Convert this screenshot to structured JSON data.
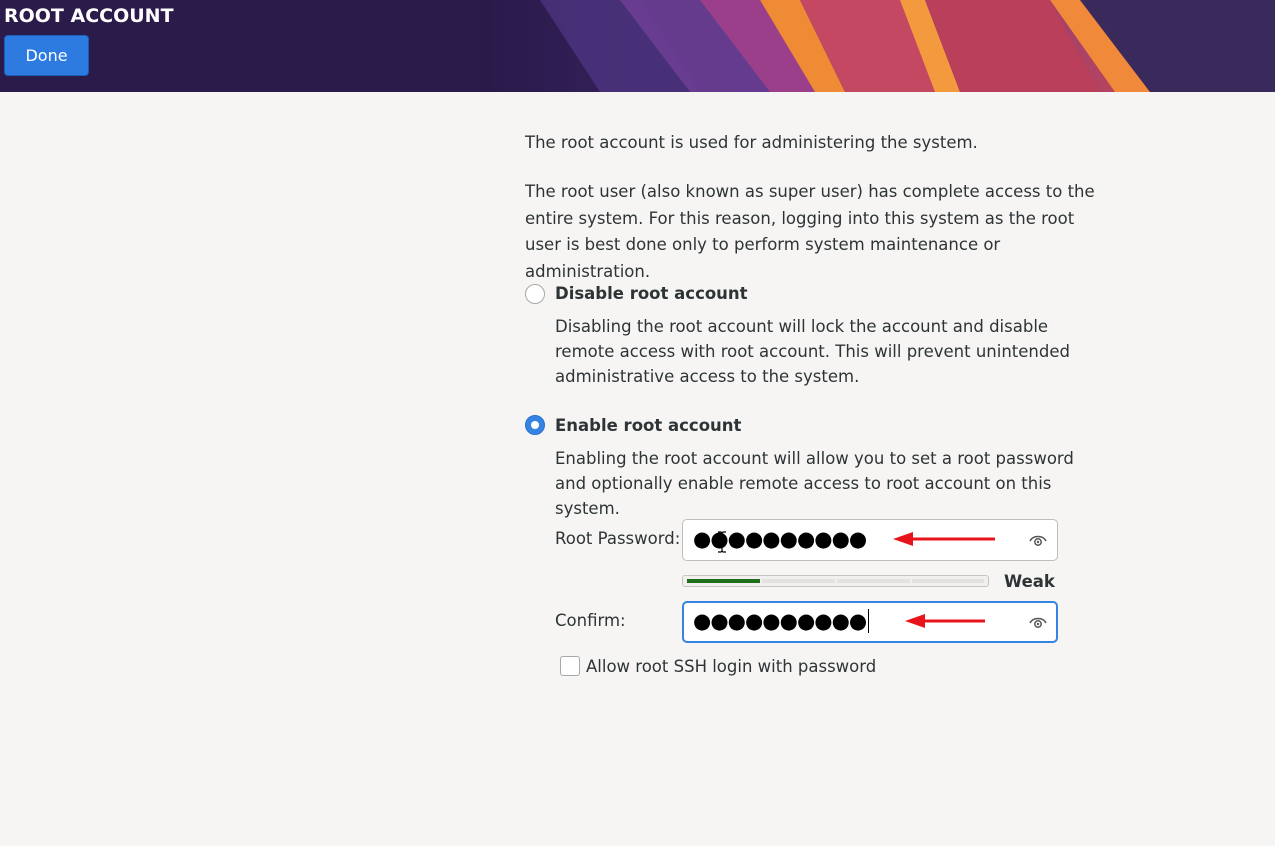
{
  "header": {
    "title": "ROOT ACCOUNT",
    "done_label": "Done"
  },
  "intro": {
    "line1": "The root account is used for administering the system.",
    "line2": "The root user (also known as super user) has complete access to the entire system. For this reason, logging into this system as the root user is best done only to perform system maintenance or administration."
  },
  "options": {
    "disable": {
      "label": "Disable root account",
      "description": "Disabling the root account will lock the account and disable remote access with root account. This will prevent unintended administrative access to the system.",
      "selected": false
    },
    "enable": {
      "label": "Enable root account",
      "description": "Enabling the root account will allow you to set a root password and optionally enable remote access to root account on this system.",
      "selected": true
    }
  },
  "password": {
    "label": "Root Password:",
    "value": "●●●●●●●●●●",
    "strength_label": "Weak",
    "strength_fraction": 0.25
  },
  "confirm": {
    "label": "Confirm:",
    "value": "●●●●●●●●●●"
  },
  "ssh": {
    "label": "Allow root SSH login with password",
    "checked": false
  },
  "colors": {
    "accent": "#3584e4",
    "done_button": "#2d7be0",
    "strength_weak": "#1d6f1a",
    "annotation_arrow": "#e8141c",
    "header_bg": "#2b1b4b"
  },
  "icons": {
    "reveal": "eye-icon",
    "annotation": "red-arrow-annotation"
  }
}
